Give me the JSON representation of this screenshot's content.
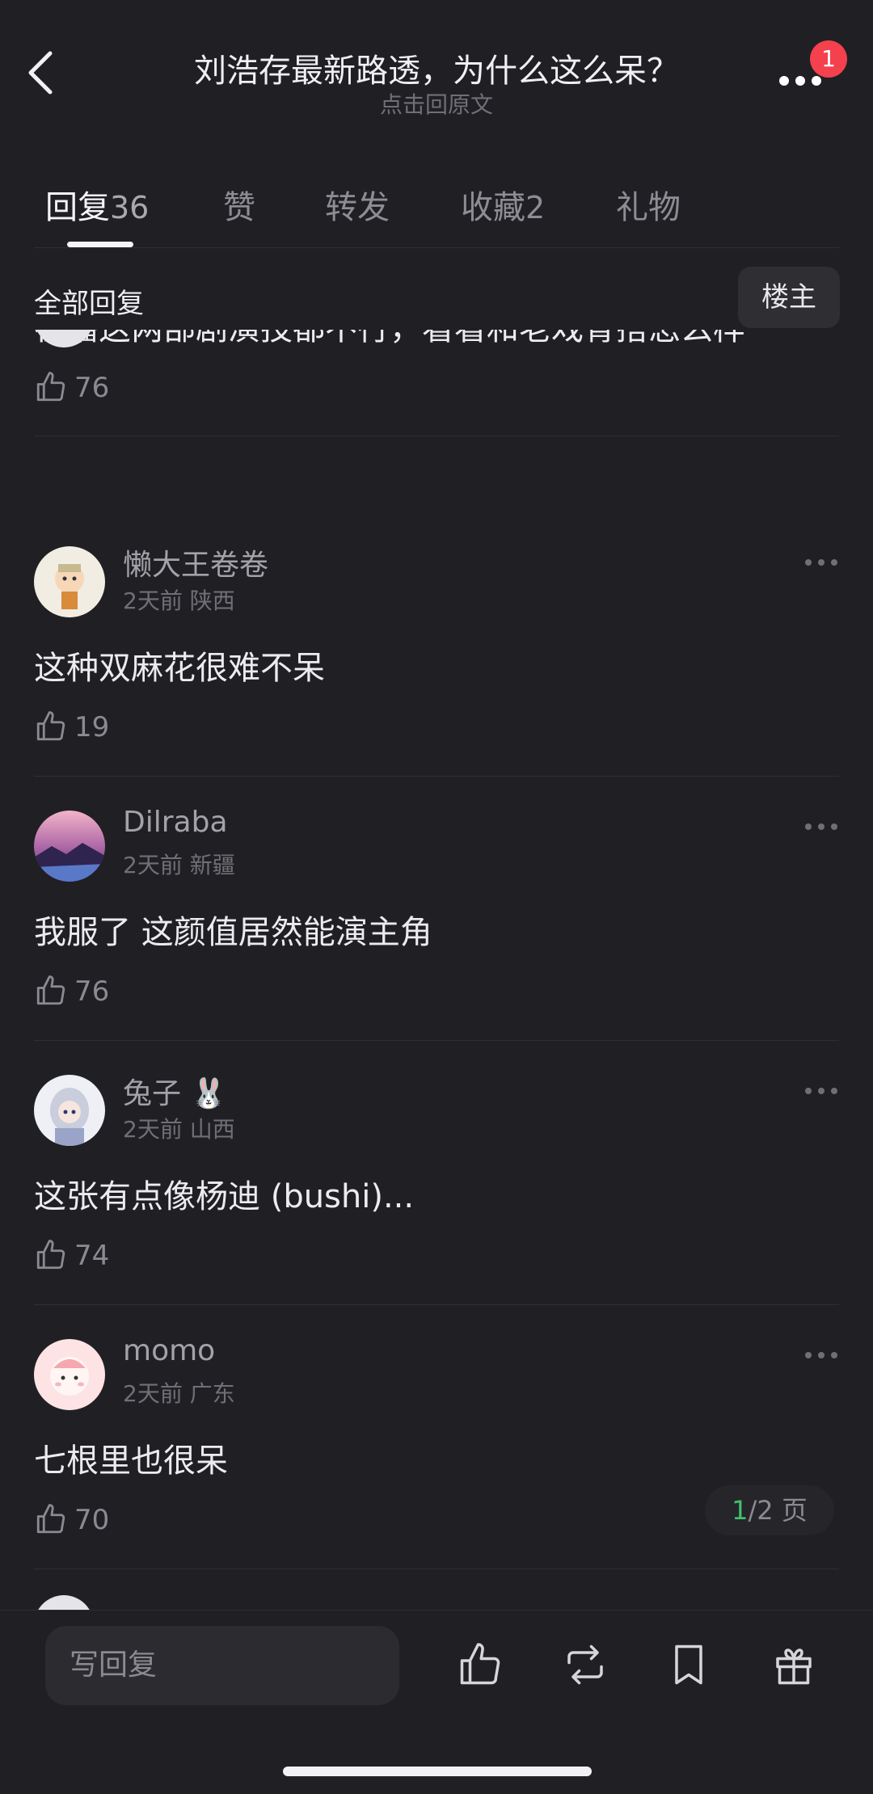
{
  "header": {
    "title": "刘浩存最新路透，为什么这么呆？",
    "subtitle": "点击回原文",
    "notification_count": "1"
  },
  "tabs": [
    {
      "label": "回复",
      "count": "36",
      "active": true
    },
    {
      "label": "赞",
      "count": ""
    },
    {
      "label": "转发",
      "count": ""
    },
    {
      "label": "收藏",
      "count": "2"
    },
    {
      "label": "礼物",
      "count": ""
    }
  ],
  "section": {
    "title": "全部回复",
    "op_filter": "楼主"
  },
  "comments": [
    {
      "name": "",
      "meta": "",
      "text": "在播这两部剧演技都不行，看看和老戏骨搭怎么样",
      "likes": "76",
      "avatar": "partially-hidden-avatar"
    },
    {
      "name": "懒大王卷卷",
      "meta": "2天前 陕西",
      "text": "这种双麻花很难不呆",
      "likes": "19",
      "avatar": "cartoon-character-avatar"
    },
    {
      "name": "Dilraba",
      "meta": "2天前 新疆",
      "text": "我服了 这颜值居然能演主角",
      "likes": "76",
      "avatar": "landscape-avatar"
    },
    {
      "name": "兔子",
      "name_emoji": "🐰",
      "meta": "2天前 山西",
      "text": "这张有点像杨迪 (bushi)...",
      "likes": "74",
      "avatar": "anime-girl-avatar"
    },
    {
      "name": "momo",
      "meta": "2天前 广东",
      "text": "七根里也很呆",
      "likes": "70",
      "avatar": "pink-cartoon-avatar"
    }
  ],
  "pager": {
    "current": "1",
    "total_text": "/2 页"
  },
  "bottom_bar": {
    "reply_placeholder": "写回复",
    "icons": [
      "thumbs-up-icon",
      "repost-icon",
      "bookmark-icon",
      "gift-icon"
    ]
  },
  "colors": {
    "background": "#202024",
    "badge": "#f4414d",
    "pager_current": "#3fc46b"
  }
}
